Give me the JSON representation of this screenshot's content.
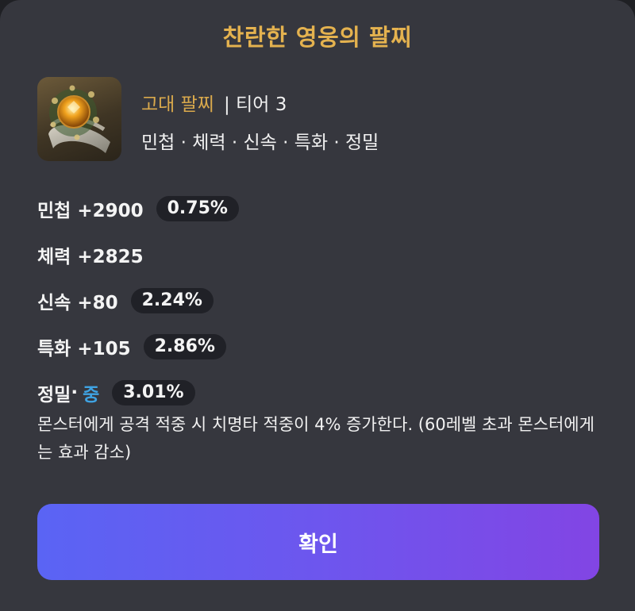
{
  "dialog": {
    "title": "찬란한 영웅의 팔찌"
  },
  "item": {
    "icon": "bracelet-item-icon",
    "grade": "고대 팔찌",
    "tier": "| 티어 3",
    "stat_list": "민첩 · 체력 · 신속 · 특화 · 정밀"
  },
  "stats": [
    {
      "label": "민첩 +2900",
      "percent": "0.75%"
    },
    {
      "label": "체력 +2825"
    },
    {
      "label": "신속 +80",
      "percent": "2.24%"
    },
    {
      "label": "특화 +105",
      "percent": "2.86%"
    },
    {
      "label": "정밀",
      "separator": " ·",
      "grade": "중",
      "percent": "3.01%"
    }
  ],
  "effect_text": "몬스터에게 공격 적중 시 치명타 적중이 4% 증가한다. (60레벨 초과 몬스터에게는 효과 감소)",
  "confirm_label": "확인",
  "colors": {
    "title": "#e4b24f",
    "grade_text": "#d9a94c",
    "grade_mid": "#3fa3e3",
    "button_start": "#5a64f4",
    "button_end": "#8245e4",
    "panel": "#36373e"
  }
}
